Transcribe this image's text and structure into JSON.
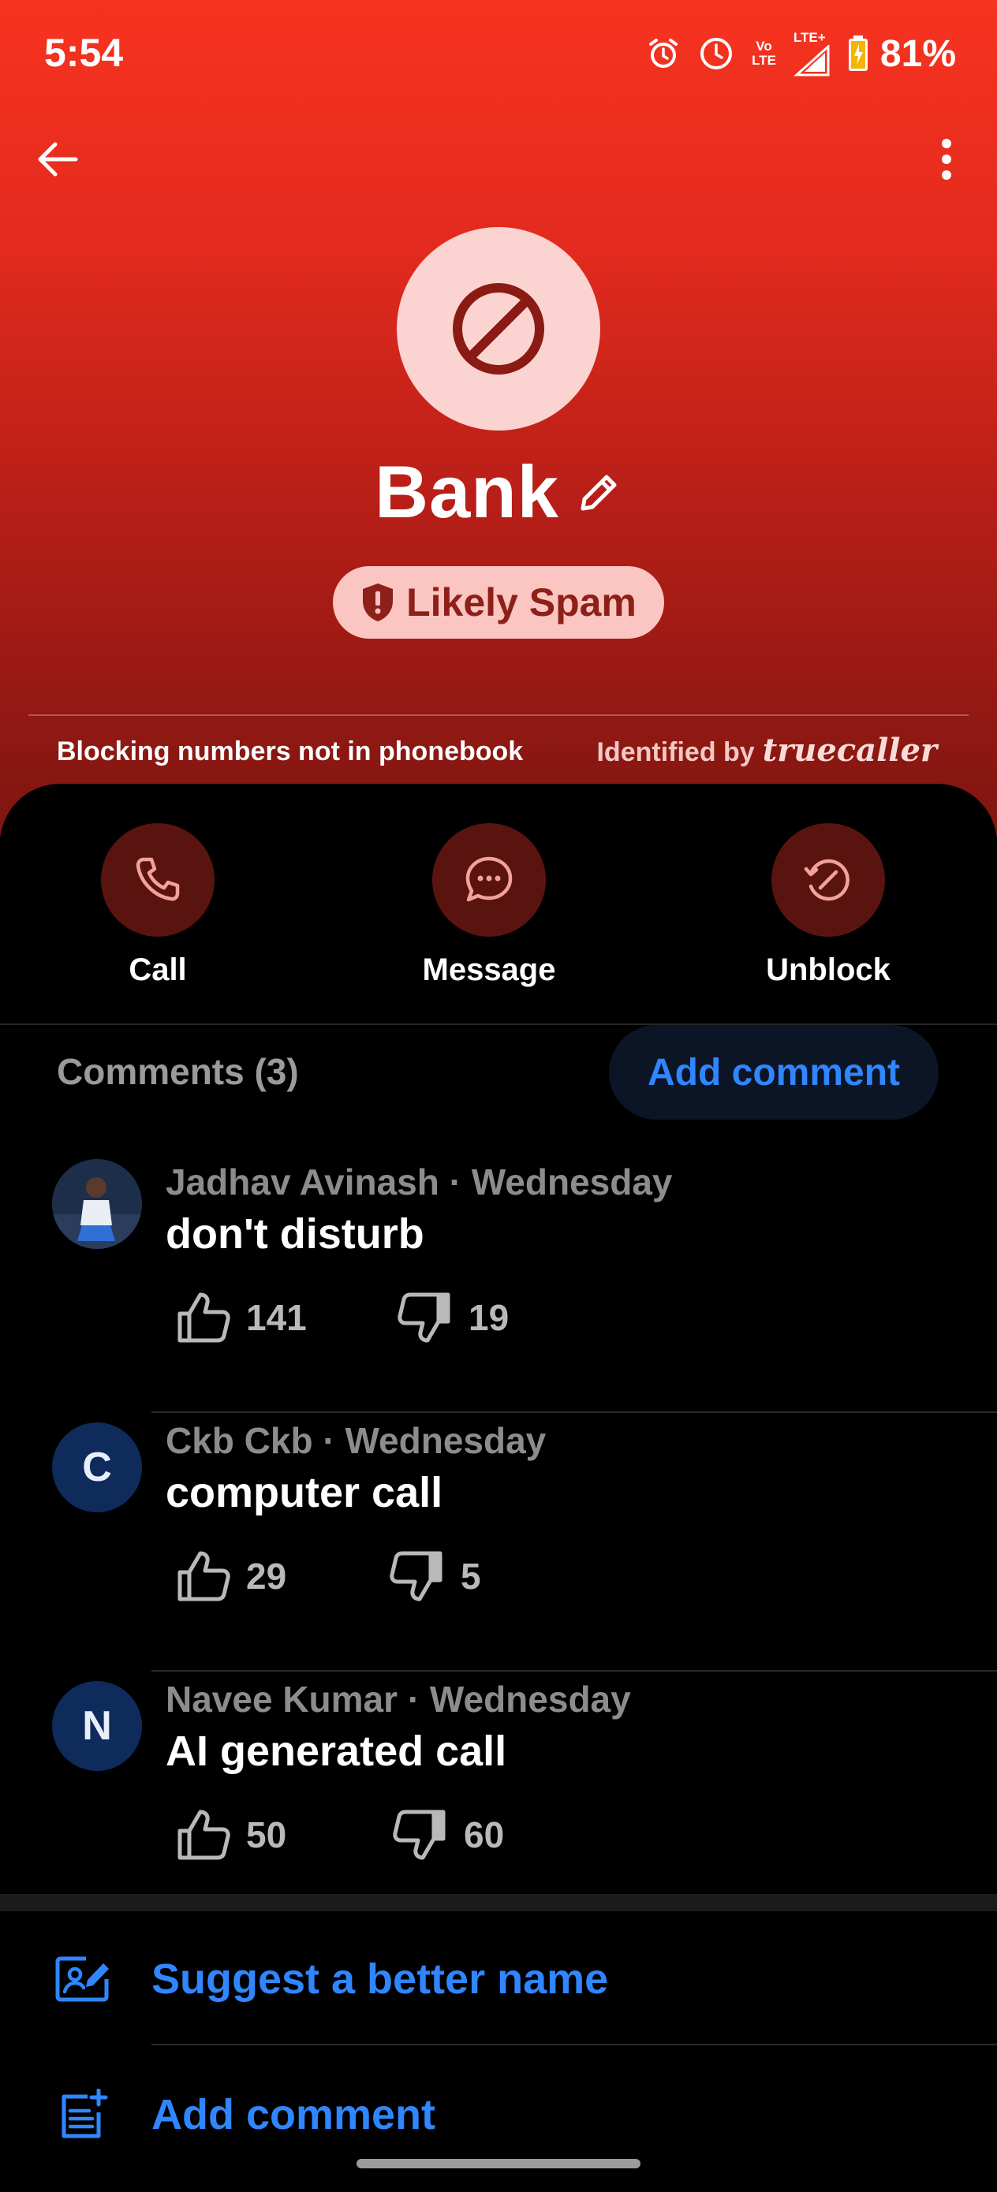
{
  "status_bar": {
    "time": "5:54",
    "network_label_top": "Vo",
    "network_label_bottom": "LTE",
    "lte_label": "LTE+",
    "battery_percent": "81%",
    "icons": [
      "alarm-icon",
      "clock-icon",
      "volte-icon",
      "signal-icon",
      "battery-icon"
    ]
  },
  "header": {
    "contact_name": "Bank",
    "spam_badge": "Likely Spam",
    "blocking_note": "Blocking numbers not in phonebook",
    "identified_by": "Identified by",
    "brand": "truecaller"
  },
  "actions": [
    {
      "label": "Call",
      "icon": "phone-icon"
    },
    {
      "label": "Message",
      "icon": "message-icon"
    },
    {
      "label": "Unblock",
      "icon": "unblock-icon"
    }
  ],
  "comments_section": {
    "title": "Comments (3)",
    "add_button": "Add comment",
    "items": [
      {
        "author_line": "Jadhav Avinash · Wednesday",
        "text": "don't disturb",
        "likes": "141",
        "dislikes": "19",
        "avatar": "photo"
      },
      {
        "author_line": "Ckb Ckb · Wednesday",
        "text": "computer call",
        "likes": "29",
        "dislikes": "5",
        "avatar": "C"
      },
      {
        "author_line": "Navee Kumar · Wednesday",
        "text": "AI generated call",
        "likes": "50",
        "dislikes": "60",
        "avatar": "N"
      }
    ]
  },
  "menu": [
    {
      "label": "Suggest a better name",
      "icon": "edit-name-icon"
    },
    {
      "label": "Add comment",
      "icon": "add-note-icon"
    }
  ],
  "colors": {
    "hero_top": "#f7331f",
    "hero_bottom": "#7e1510",
    "accent_blue": "#2f86ff",
    "action_circle": "#5a1410",
    "avatar_bg": "#0f2b5c"
  }
}
